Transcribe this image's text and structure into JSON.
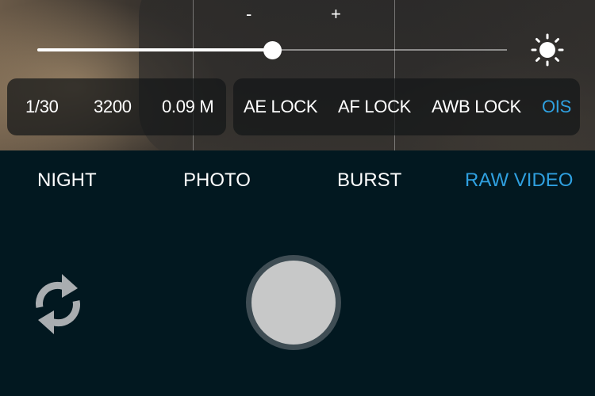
{
  "exposure": {
    "minus_label": "-",
    "plus_label": "+",
    "slider_value": 0.5,
    "icon": "sun-icon"
  },
  "info_left": {
    "shutter": "1/30",
    "iso": "3200",
    "focus": "0.09 M"
  },
  "info_right": {
    "ae_lock": "AE LOCK",
    "af_lock": "AF LOCK",
    "awb_lock": "AWB LOCK",
    "ois": "OIS"
  },
  "modes": [
    {
      "label": "NIGHT",
      "active": false
    },
    {
      "label": "PHOTO",
      "active": false
    },
    {
      "label": "BURST",
      "active": false
    },
    {
      "label": "RAW VIDEO",
      "active": true
    }
  ],
  "controls": {
    "switch_camera_icon": "switch-camera-icon",
    "shutter": "shutter-button"
  },
  "colors": {
    "accent": "#2fa0e0",
    "background": "#021820",
    "shutter": "#c7c8c8",
    "shutter_ring": "#3f4d54",
    "icon_gray": "#a9adb0"
  }
}
